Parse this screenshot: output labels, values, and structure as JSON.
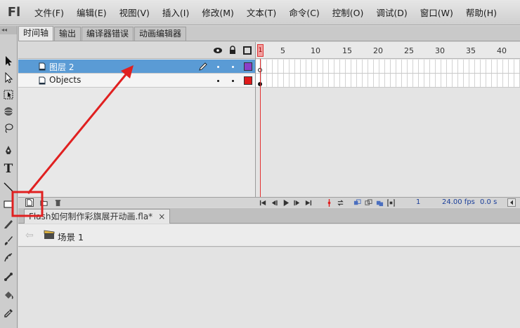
{
  "app": {
    "logo": "Fl"
  },
  "menu": [
    "文件(F)",
    "编辑(E)",
    "视图(V)",
    "插入(I)",
    "修改(M)",
    "文本(T)",
    "命令(C)",
    "控制(O)",
    "调试(D)",
    "窗口(W)",
    "帮助(H)"
  ],
  "tabs": [
    "时间轴",
    "输出",
    "编译器错误",
    "动画编辑器"
  ],
  "tool_strip": {
    "collapse": "◂◂"
  },
  "tools": [
    "selection-tool",
    "subselection-tool",
    "free-transform-tool",
    "3d-rotation-tool",
    "lasso-tool",
    "pen-tool",
    "text-tool",
    "line-tool",
    "rectangle-tool",
    "pencil-tool",
    "brush-tool",
    "deco-tool",
    "bone-tool",
    "paint-bucket-tool",
    "eyedropper-tool"
  ],
  "text_tool_glyph": "T",
  "layers": [
    {
      "name": "图层 2",
      "color": "#8b3fc9",
      "selected": true
    },
    {
      "name": "Objects",
      "color": "#e01b1b",
      "selected": false
    }
  ],
  "ruler": {
    "playhead": "1",
    "ticks": [
      "5",
      "10",
      "15",
      "20",
      "25",
      "30",
      "35",
      "40"
    ]
  },
  "status": {
    "current_frame": "1",
    "fps": "24.00 fps",
    "time": "0.0 s"
  },
  "document": {
    "tab_title": "Flash如何制作彩旗展开动画.fla*",
    "close": "×",
    "back": "⇦",
    "scene": "场景 1"
  },
  "colors": {
    "selection_blue": "#5a9bd5",
    "annotation_red": "#e02020",
    "playhead_red": "#e23030"
  },
  "annotation": {
    "highlights": "new-layer-button"
  }
}
